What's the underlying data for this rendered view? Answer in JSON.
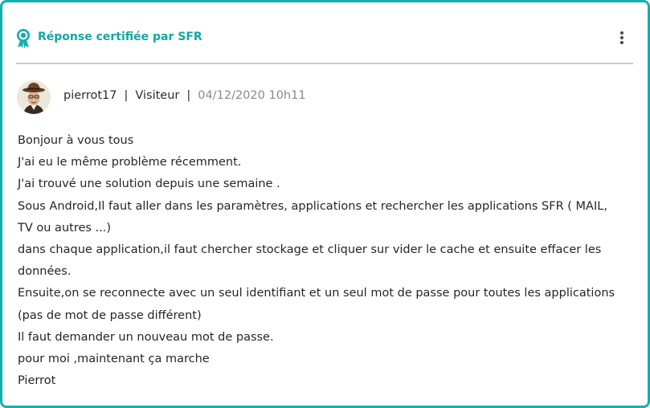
{
  "header": {
    "title": "Réponse certifiée par SFR",
    "badge_icon": "award-ribbon-icon",
    "menu_icon": "more-vertical-icon",
    "accent_color": "#12b0ae"
  },
  "author": {
    "name": "pierrot17",
    "role": "Visiteur",
    "date": "04/12/2020 10h11",
    "separator": "|"
  },
  "body": {
    "lines": [
      "Bonjour à vous tous",
      "J'ai eu le même problème récemment.",
      "J'ai trouvé une solution depuis une semaine .",
      "Sous Android,Il faut aller dans les paramètres,  applications et rechercher les applications  SFR ( MAIL,",
      "TV ou autres ...)",
      "dans chaque application,il faut chercher  stockage  et cliquer sur vider le cache  et ensuite effacer les",
      "données.",
      "Ensuite,on se reconnecte avec un seul identifiant et un seul mot de passe pour toutes les applications",
      "(pas de mot de passe différent)",
      "Il faut demander un nouveau mot de passe.",
      "pour moi ,maintenant ça marche",
      "Pierrot"
    ]
  }
}
